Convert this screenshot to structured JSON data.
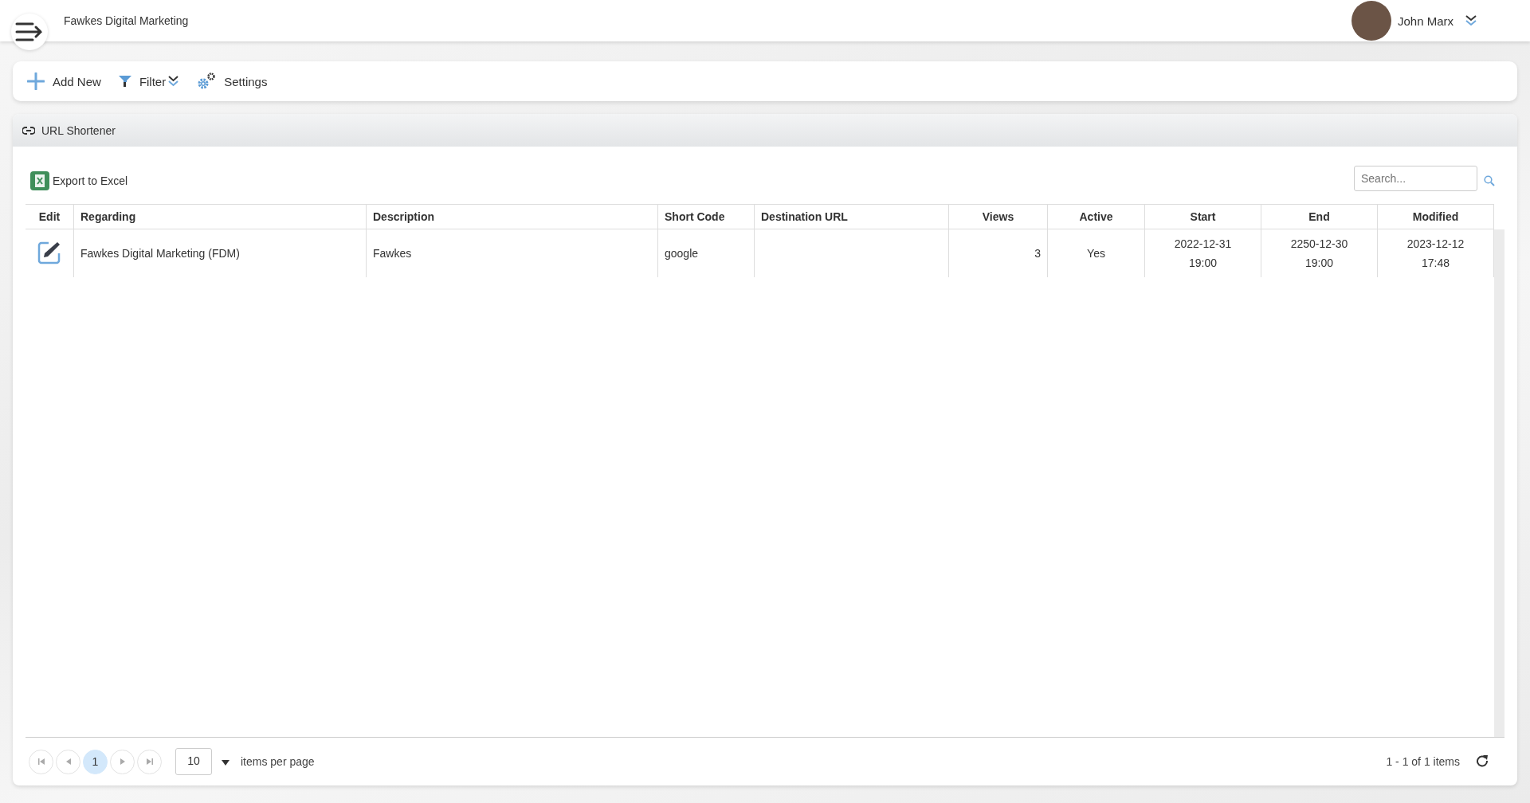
{
  "header": {
    "company": "Fawkes Digital Marketing",
    "user": "John Marx"
  },
  "toolbar": [
    {
      "kind": "add",
      "label": "Add New"
    },
    {
      "kind": "filter",
      "label": "Filter"
    },
    {
      "kind": "settings",
      "label": "Settings"
    }
  ],
  "panel": {
    "title": "URL Shortener",
    "export_label": "Export to Excel",
    "search": {
      "placeholder": "Search..."
    }
  },
  "table": {
    "columns": [
      {
        "label": "Edit",
        "kind": "icon"
      },
      {
        "label": "Regarding",
        "kind": "text"
      },
      {
        "label": "Description",
        "kind": "text"
      },
      {
        "label": "Short Code",
        "kind": "text"
      },
      {
        "label": "Destination URL",
        "kind": "text"
      },
      {
        "label": "Views",
        "kind": "number"
      },
      {
        "label": "Active",
        "kind": "center"
      },
      {
        "label": "Start",
        "kind": "center"
      },
      {
        "label": "End",
        "kind": "center"
      },
      {
        "label": "Modified",
        "kind": "center"
      }
    ],
    "rows": [
      {
        "cells": [
          "",
          "Fawkes Digital Marketing (FDM)",
          "Fawkes",
          "google",
          "",
          "3",
          "Yes",
          [
            "2022-12-31",
            "19:00"
          ],
          [
            "2250-12-30",
            "19:00"
          ],
          [
            "2023-12-12",
            "17:48"
          ]
        ]
      }
    ]
  },
  "pager": {
    "pages": [
      {
        "label": "1",
        "selected": true
      }
    ],
    "page_size": "10",
    "per_page_label": "items per page",
    "info": "1 - 1 of 1 items"
  }
}
